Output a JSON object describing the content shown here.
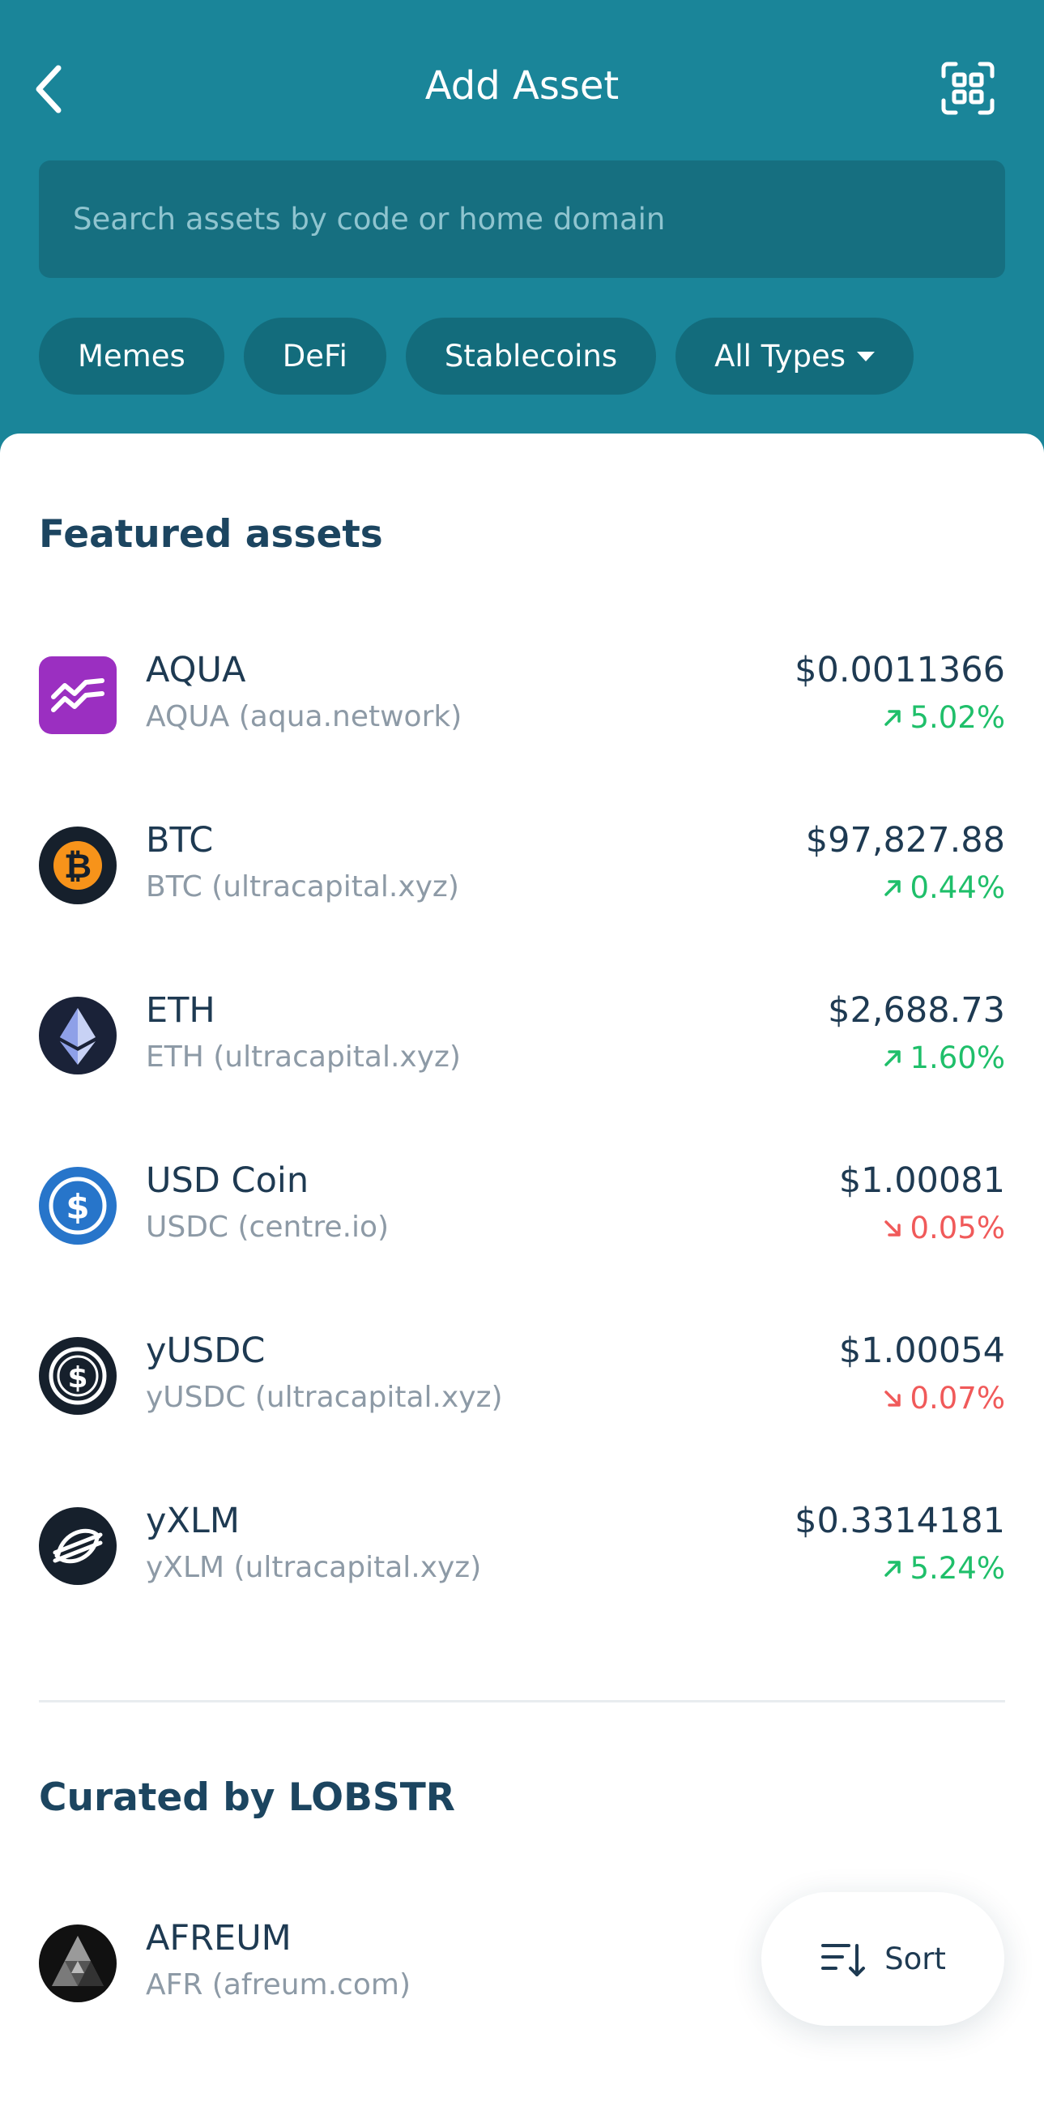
{
  "header": {
    "title": "Add Asset",
    "back_icon": "chevron-left-icon",
    "scan_icon": "qr-scan-icon"
  },
  "search": {
    "placeholder": "Search assets by code or home domain",
    "value": ""
  },
  "filters": [
    {
      "label": "Memes"
    },
    {
      "label": "DeFi"
    },
    {
      "label": "Stablecoins"
    },
    {
      "label": "All Types",
      "dropdown": true
    }
  ],
  "featured": {
    "title": "Featured assets",
    "assets": [
      {
        "name": "AQUA",
        "sub": "AQUA (aqua.network)",
        "price": "$0.0011366",
        "change": "5.02%",
        "direction": "up",
        "icon": "aqua-icon"
      },
      {
        "name": "BTC",
        "sub": "BTC (ultracapital.xyz)",
        "price": "$97,827.88",
        "change": "0.44%",
        "direction": "up",
        "icon": "bitcoin-icon"
      },
      {
        "name": "ETH",
        "sub": "ETH (ultracapital.xyz)",
        "price": "$2,688.73",
        "change": "1.60%",
        "direction": "up",
        "icon": "ethereum-icon"
      },
      {
        "name": "USD Coin",
        "sub": "USDC (centre.io)",
        "price": "$1.00081",
        "change": "0.05%",
        "direction": "down",
        "icon": "usdc-icon"
      },
      {
        "name": "yUSDC",
        "sub": "yUSDC (ultracapital.xyz)",
        "price": "$1.00054",
        "change": "0.07%",
        "direction": "down",
        "icon": "yusdc-icon"
      },
      {
        "name": "yXLM",
        "sub": "yXLM (ultracapital.xyz)",
        "price": "$0.3314181",
        "change": "5.24%",
        "direction": "up",
        "icon": "stellar-icon"
      }
    ]
  },
  "curated": {
    "title": "Curated by LOBSTR",
    "assets": [
      {
        "name": "AFREUM",
        "sub": "AFR (afreum.com)",
        "icon": "afreum-icon"
      }
    ]
  },
  "sort_button": {
    "label": "Sort",
    "icon": "sort-icon"
  },
  "colors": {
    "header_bg": "#1a8599",
    "up": "#1fbf6a",
    "down": "#f05a5a",
    "text": "#1e3a52"
  }
}
